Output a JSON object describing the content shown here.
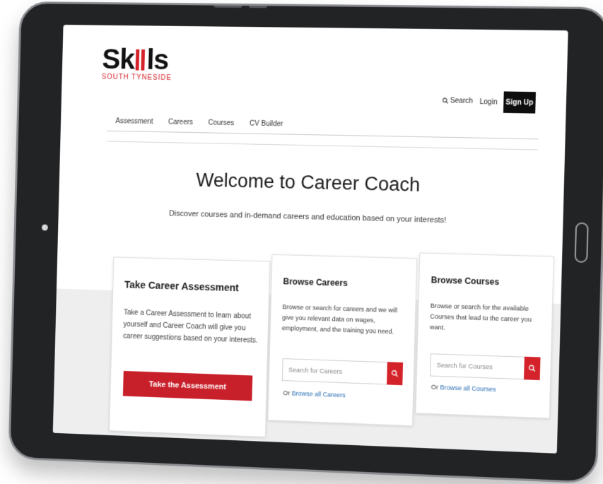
{
  "brand": {
    "name_left": "Sk",
    "name_right": "ls",
    "subtitle": "SOUTH TYNESIDE",
    "accent": "#d4222a"
  },
  "header": {
    "search_label": "Search",
    "login_label": "Login",
    "signup_label": "Sign Up"
  },
  "nav": {
    "items": [
      "Assessment",
      "Careers",
      "Courses",
      "CV Builder"
    ]
  },
  "hero": {
    "title": "Welcome to Career Coach",
    "tagline": "Discover courses and in-demand careers and education based on your interests!"
  },
  "cards": {
    "assessment": {
      "title": "Take Career Assessment",
      "description": "Take a Career Assessment to learn about yourself and Career Coach will give you career suggestions based on your interests.",
      "button_label": "Take the Assessment"
    },
    "careers": {
      "title": "Browse Careers",
      "description": "Browse or search for careers and we will give you relevant data on wages, employment, and the training you need.",
      "search_placeholder": "Search for Careers",
      "browse_prefix": "Or ",
      "browse_link": "Browse all Careers"
    },
    "courses": {
      "title": "Browse Courses",
      "description": "Browse or search for the available Courses that lead to the career you want.",
      "search_placeholder": "Search for Courses",
      "browse_prefix": "Or ",
      "browse_link": "Browse all Courses"
    }
  },
  "icons": {
    "search": "search-icon",
    "search_button": "search-icon"
  }
}
